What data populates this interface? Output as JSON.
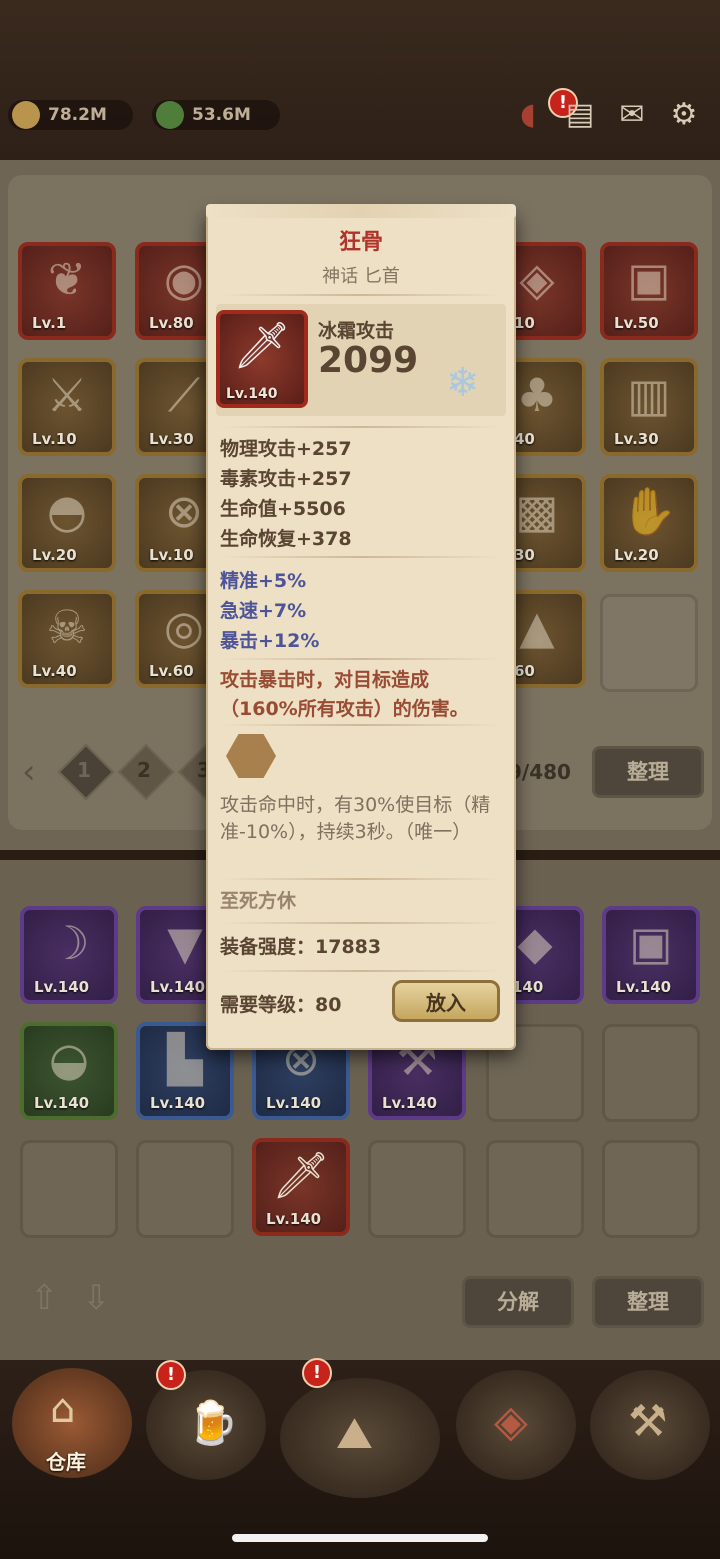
{
  "top": {
    "gold": "78.2M",
    "gems": "53.6M",
    "icons": [
      "horn-icon",
      "chat-icon",
      "mail-icon",
      "gear-icon"
    ]
  },
  "inventory": {
    "levels": [
      "Lv.1",
      "Lv.80",
      "10",
      "Lv.50",
      "Lv.10",
      "Lv.30",
      "40",
      "Lv.30",
      "Lv.20",
      "Lv.10",
      "30",
      "Lv.20",
      "Lv.40",
      "Lv.60",
      "60"
    ],
    "pages": [
      "1",
      "2",
      "3"
    ],
    "count": "9/480",
    "sort_label": "整理"
  },
  "equipment": {
    "levels": [
      "Lv.140",
      "Lv.140",
      "140",
      "Lv.140",
      "Lv.140",
      "Lv.140",
      "Lv.140",
      "Lv.140",
      "Lv.140"
    ],
    "decompose_label": "分解",
    "sort_label": "整理"
  },
  "nav": {
    "warehouse_label": "仓库"
  },
  "popup": {
    "name": "狂骨",
    "subtitle": "神话 匕首",
    "icon_level": "Lv.140",
    "main_stat_name": "冰霜攻击",
    "main_stat_value": "2099",
    "stats": [
      "物理攻击+257",
      "毒素攻击+257",
      "生命值+5506",
      "生命恢复+378"
    ],
    "bonus_stats": [
      "精准+5%",
      "急速+7%",
      "暴击+12%"
    ],
    "skill1": "攻击暴击时，对目标造成（160%所有攻击）的伤害。",
    "skill2": "攻击命中时，有30%使目标（精准-10%），持续3秒。（唯一）",
    "set_name": "至死方休",
    "power_label": "装备强度：17883",
    "req_label": "需要等级：80",
    "put_button": "放入"
  },
  "colors": {
    "popup_bg": "#ede0c5",
    "title": "#b0332a",
    "bonus": "#4d5598",
    "skill": "#9a4b34"
  }
}
